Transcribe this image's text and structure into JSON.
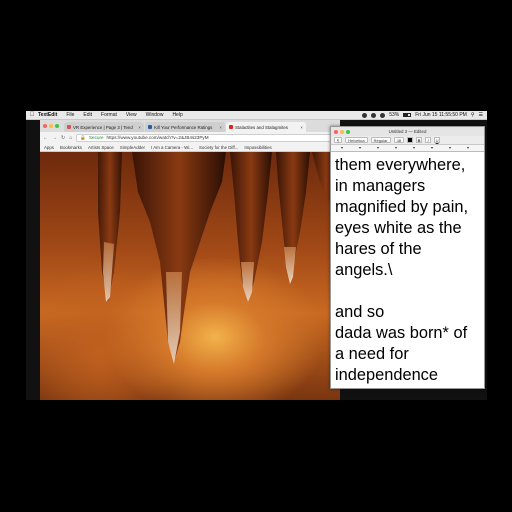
{
  "menubar": {
    "apple_icon": "apple-icon",
    "items": [
      {
        "label": "TextEdit"
      },
      {
        "label": "File"
      },
      {
        "label": "Edit"
      },
      {
        "label": "Format"
      },
      {
        "label": "View"
      },
      {
        "label": "Window"
      },
      {
        "label": "Help"
      }
    ],
    "clock": "Fri Jun 15  11:55:50 PM",
    "battery": "53%"
  },
  "browser": {
    "tabs": [
      {
        "title": "VR Experience | Page 3 | Tend",
        "favicon_color": "#d9534f"
      },
      {
        "title": "Kill Your Performance Ratings",
        "favicon_color": "#2a5ca8"
      },
      {
        "title": "Stalactites and Stalagmites",
        "favicon_color": "#e62117"
      }
    ],
    "address": {
      "secure_label": "Secure",
      "url": "https://www.youtube.com/watch?v=2&JB4s23PyM"
    },
    "bookmarks": [
      {
        "label": "Apps"
      },
      {
        "label": "Bookmarks"
      },
      {
        "label": "Artists Space"
      },
      {
        "label": "SimpleAdder"
      },
      {
        "label": "I Am a Camera - Wi..."
      },
      {
        "label": "Society for the Diff..."
      },
      {
        "label": "Impossibilities"
      }
    ]
  },
  "textedit": {
    "title": "Untitled 3 — Edited",
    "format": {
      "style": "Helvetica",
      "weight": "Regular",
      "size": "48"
    },
    "document": "them everywhere,\nin managers\nmagnified by pain,\neyes white as the\nhares of the\nangels.\\\n\nand so\ndada was born* of\na need for\nindependence"
  },
  "colors": {
    "traffic_red": "#fc605c",
    "traffic_yellow": "#fdbc40",
    "traffic_green": "#34c84a"
  }
}
